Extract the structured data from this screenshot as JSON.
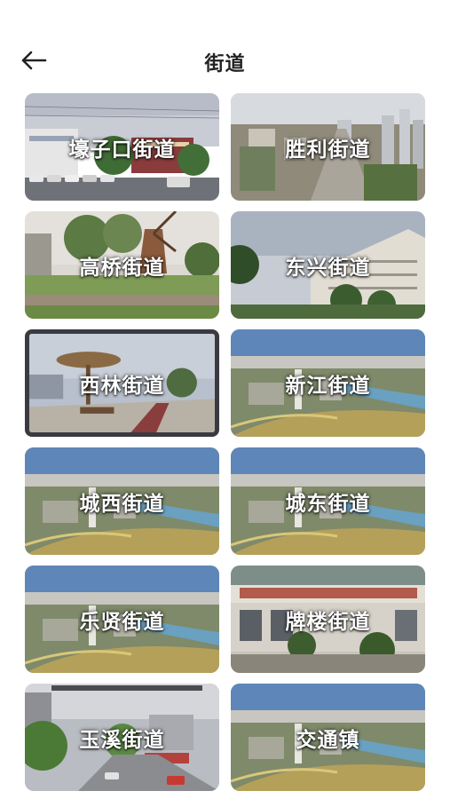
{
  "header": {
    "title": "街道"
  },
  "streets": [
    {
      "label": "壕子口街道"
    },
    {
      "label": "胜利街道"
    },
    {
      "label": "高桥街道"
    },
    {
      "label": "东兴街道"
    },
    {
      "label": "西林街道"
    },
    {
      "label": "新江街道"
    },
    {
      "label": "城西街道"
    },
    {
      "label": "城东街道"
    },
    {
      "label": "乐贤街道"
    },
    {
      "label": "牌楼街道"
    },
    {
      "label": "玉溪街道"
    },
    {
      "label": "交通镇"
    }
  ]
}
